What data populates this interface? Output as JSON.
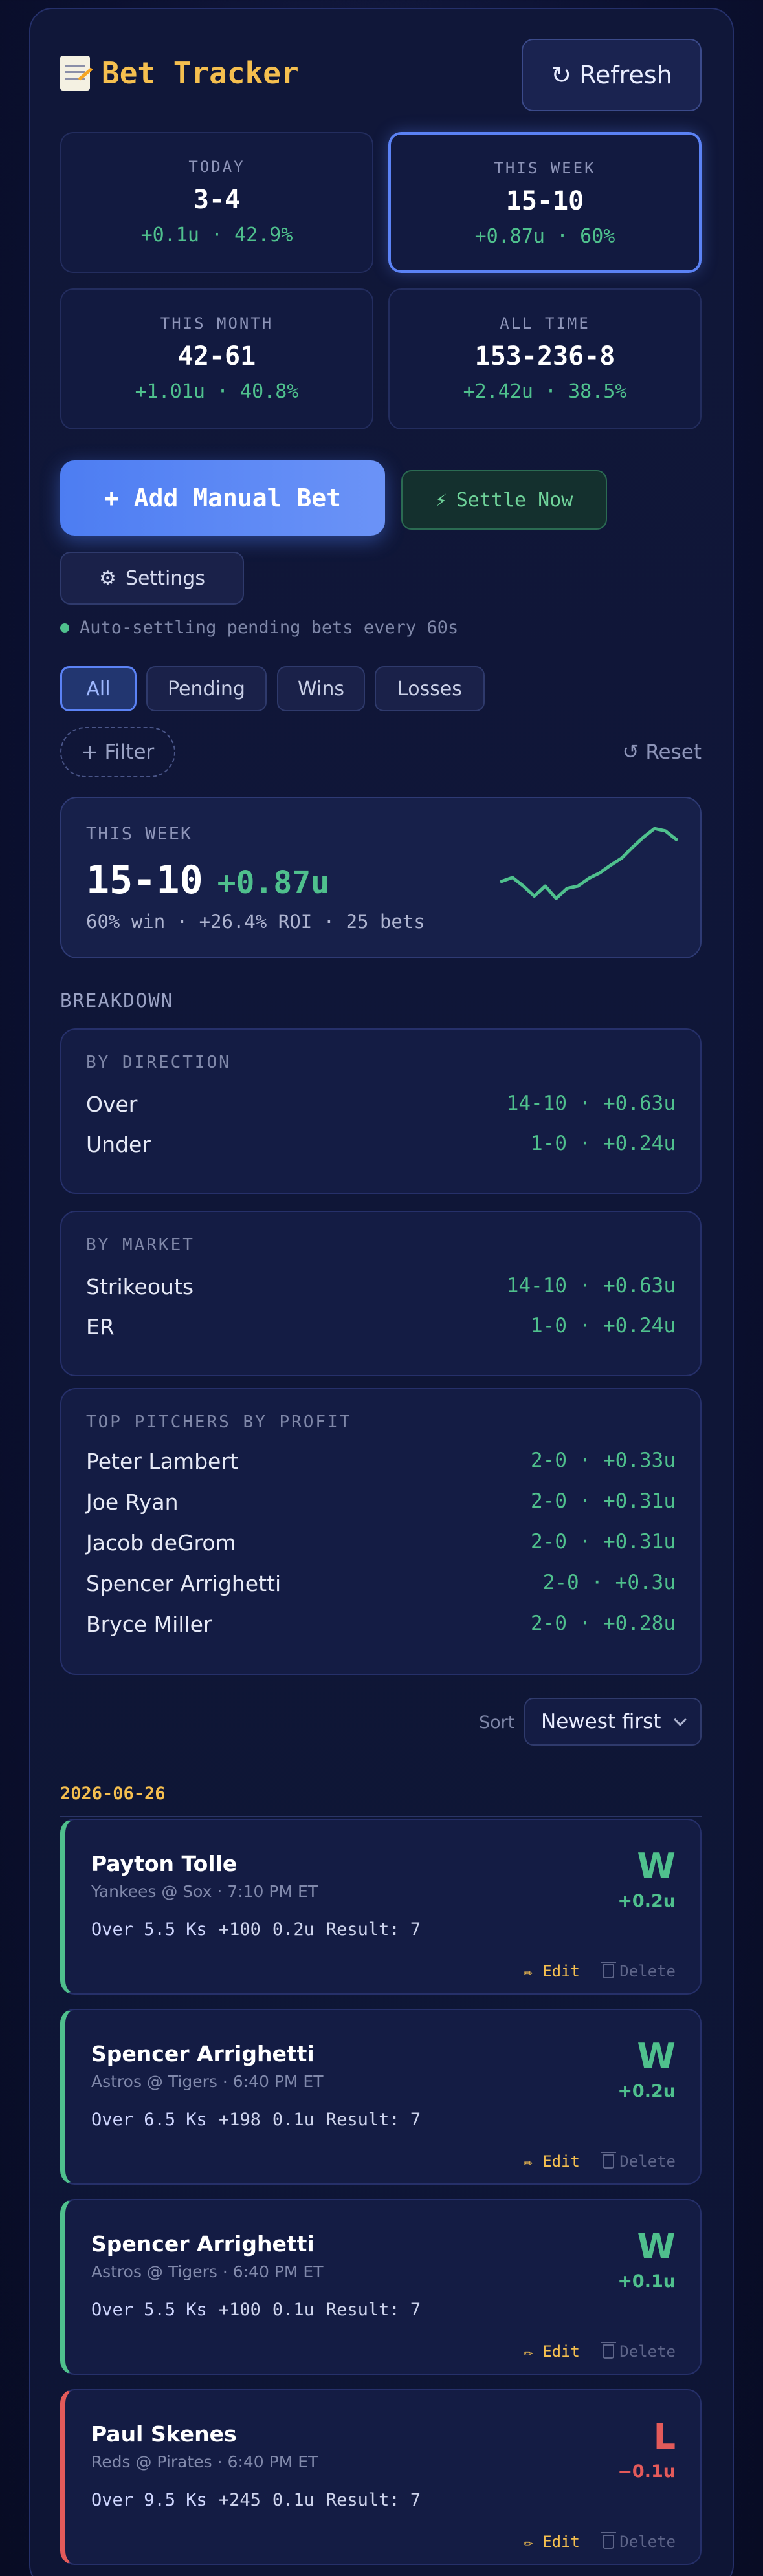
{
  "header": {
    "title": "Bet Tracker",
    "refresh_label": "↻ Refresh"
  },
  "stats": [
    {
      "label": "TODAY",
      "record": "3-4",
      "pl": "+0.1u · 42.9%"
    },
    {
      "label": "THIS WEEK",
      "record": "15-10",
      "pl": "+0.87u · 60%"
    },
    {
      "label": "THIS MONTH",
      "record": "42-61",
      "pl": "+1.01u · 40.8%"
    },
    {
      "label": "ALL TIME",
      "record": "153-236-8",
      "pl": "+2.42u · 38.5%"
    }
  ],
  "actions": {
    "add_label": "+ Add Manual Bet",
    "settle_label": "Settle Now",
    "settings_label": "Settings"
  },
  "auto_settle_text": "Auto-settling pending bets every 60s",
  "filters": {
    "tabs": [
      "All",
      "Pending",
      "Wins",
      "Losses"
    ],
    "active": "All",
    "add_filter_label": "+ Filter",
    "reset_label": "↺ Reset"
  },
  "week_summary": {
    "label": "THIS WEEK",
    "record": "15-10",
    "units": "+0.87u",
    "sub": "60% win · +26.4% ROI · 25 bets",
    "sparkline": [
      0.26,
      0.31,
      0.2,
      0.07,
      0.2,
      0.04,
      0.17,
      0.2,
      0.3,
      0.37,
      0.47,
      0.56,
      0.7,
      0.83,
      0.94,
      0.91,
      0.8
    ]
  },
  "breakdown": {
    "heading": "BREAKDOWN",
    "by_direction": {
      "label": "BY DIRECTION",
      "rows": [
        {
          "name": "Over",
          "value": "14-10 · +0.63u"
        },
        {
          "name": "Under",
          "value": "1-0 · +0.24u"
        }
      ]
    },
    "by_market": {
      "label": "BY MARKET",
      "rows": [
        {
          "name": "Strikeouts",
          "value": "14-10 · +0.63u"
        },
        {
          "name": "ER",
          "value": "1-0 · +0.24u"
        }
      ]
    },
    "top_pitchers": {
      "label": "TOP PITCHERS BY PROFIT",
      "rows": [
        {
          "name": "Peter Lambert",
          "value": "2-0 · +0.33u"
        },
        {
          "name": "Joe Ryan",
          "value": "2-0 · +0.31u"
        },
        {
          "name": "Jacob deGrom",
          "value": "2-0 · +0.31u"
        },
        {
          "name": "Spencer Arrighetti",
          "value": "2-0 · +0.3u"
        },
        {
          "name": "Bryce Miller",
          "value": "2-0 · +0.28u"
        }
      ]
    }
  },
  "sort": {
    "label": "Sort",
    "value": "Newest first"
  },
  "date_group": "2026-06-26",
  "bets": [
    {
      "pitcher": "Payton Tolle",
      "game": "Yankees @ Sox · 7:10 PM ET",
      "pick": "Over 5.5 Ks",
      "odds": "+100",
      "stake": "0.2u",
      "result_text": "Result: 7",
      "result": "W",
      "units": "+0.2u",
      "edit": "✏ Edit",
      "delete": "Delete"
    },
    {
      "pitcher": "Spencer Arrighetti",
      "game": "Astros @ Tigers · 6:40 PM ET",
      "pick": "Over 6.5 Ks",
      "odds": "+198",
      "stake": "0.1u",
      "result_text": "Result: 7",
      "result": "W",
      "units": "+0.2u",
      "edit": "✏ Edit",
      "delete": "Delete"
    },
    {
      "pitcher": "Spencer Arrighetti",
      "game": "Astros @ Tigers · 6:40 PM ET",
      "pick": "Over 5.5 Ks",
      "odds": "+100",
      "stake": "0.1u",
      "result_text": "Result: 7",
      "result": "W",
      "units": "+0.1u",
      "edit": "✏ Edit",
      "delete": "Delete"
    },
    {
      "pitcher": "Paul Skenes",
      "game": "Reds @ Pirates · 6:40 PM ET",
      "pick": "Over 9.5 Ks",
      "odds": "+245",
      "stake": "0.1u",
      "result_text": "Result: 7",
      "result": "L",
      "units": "−0.1u",
      "edit": "✏ Edit",
      "delete": "Delete"
    }
  ],
  "colors": {
    "accent": "#5b82f5",
    "win": "#4fc08d",
    "loss": "#e35a5a",
    "date": "#f5bf4f"
  }
}
